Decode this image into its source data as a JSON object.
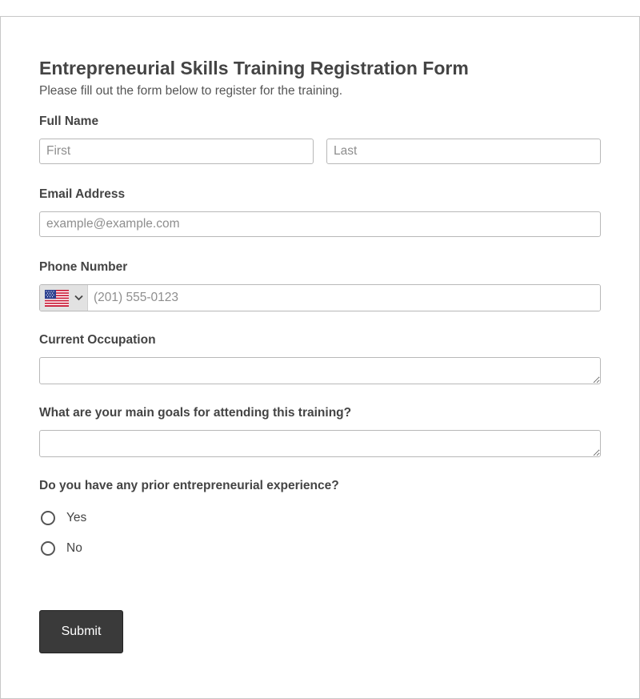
{
  "form": {
    "title": "Entrepreneurial Skills Training Registration Form",
    "subtitle": "Please fill out the form below to register for the training.",
    "full_name": {
      "label": "Full Name",
      "first_placeholder": "First",
      "last_placeholder": "Last",
      "first_value": "",
      "last_value": ""
    },
    "email": {
      "label": "Email Address",
      "placeholder": "example@example.com",
      "value": ""
    },
    "phone": {
      "label": "Phone Number",
      "country_flag": "us-flag-icon",
      "placeholder": "(201) 555-0123",
      "value": ""
    },
    "occupation": {
      "label": "Current Occupation",
      "value": ""
    },
    "goals": {
      "label": "What are your main goals for attending this training?",
      "value": ""
    },
    "experience": {
      "label": "Do you have any prior entrepreneurial experience?",
      "options": [
        {
          "label": "Yes",
          "selected": false
        },
        {
          "label": "No",
          "selected": false
        }
      ]
    },
    "submit_label": "Submit"
  },
  "colors": {
    "button_bg": "#3a3a3a",
    "border": "#b8b8b8",
    "text": "#444444"
  }
}
